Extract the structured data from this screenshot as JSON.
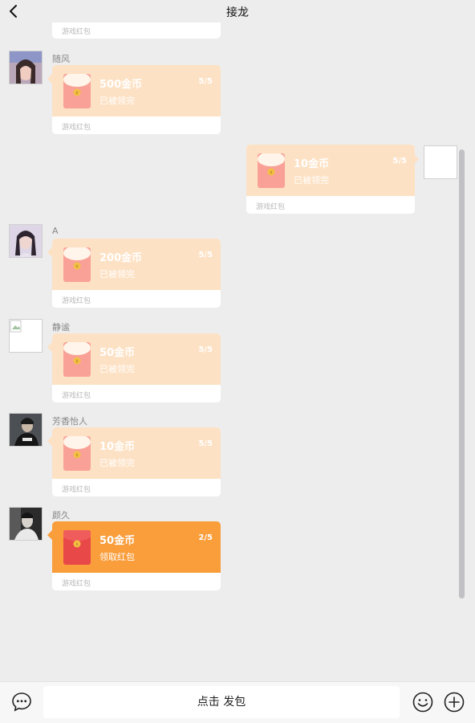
{
  "header": {
    "title": "接龙",
    "back_icon": "chevron-left-icon"
  },
  "partial_card": {
    "footer": "游戏红包"
  },
  "messages": [
    {
      "sender": "随风",
      "amount": "500金币",
      "status": "已被领完",
      "count": "5/5",
      "footer": "游戏红包",
      "side": "left",
      "active": false
    },
    {
      "sender": "",
      "amount": "10金币",
      "status": "已被领完",
      "count": "5/5",
      "footer": "游戏红包",
      "side": "right",
      "active": false
    },
    {
      "sender": "A",
      "amount": "200金币",
      "status": "已被领完",
      "count": "5/5",
      "footer": "游戏红包",
      "side": "left",
      "active": false
    },
    {
      "sender": "静谧",
      "amount": "50金币",
      "status": "已被领完",
      "count": "5/5",
      "footer": "游戏红包",
      "side": "left",
      "active": false
    },
    {
      "sender": "芳香怡人",
      "amount": "10金币",
      "status": "已被领完",
      "count": "5/5",
      "footer": "游戏红包",
      "side": "left",
      "active": false
    },
    {
      "sender": "颜久",
      "amount": "50金币",
      "status": "领取红包",
      "count": "2/5",
      "footer": "游戏红包",
      "side": "left",
      "active": true
    }
  ],
  "input": {
    "placeholder": "点击 发包"
  },
  "colors": {
    "card_done": "#fde1c4",
    "card_active": "#fa9d3b",
    "envelope_done": "#f9a196",
    "envelope_active": "#e84848",
    "background": "#ededed"
  },
  "icons": {
    "voice": "voice-message-icon",
    "emoji": "smiley-icon",
    "plus": "plus-circle-icon"
  }
}
